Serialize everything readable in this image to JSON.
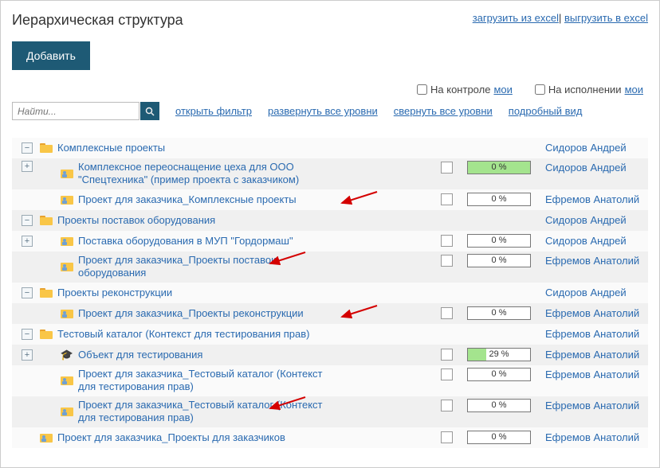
{
  "title": "Иерархическая структура",
  "header_links": {
    "import": "загрузить из excel",
    "export": "выгрузить в excel"
  },
  "add_btn": "Добавить",
  "search": {
    "placeholder": "Найти..."
  },
  "toolbar": {
    "open_filter": "открыть фильтр",
    "expand_all": "развернуть все уровни",
    "collapse_all": "свернуть все уровни",
    "detailed": "подробный вид",
    "on_control_txt": "На контроле",
    "on_exec_txt": "На исполнении",
    "mine": "мои"
  },
  "owners": {
    "sidorov": "Сидоров Андрей",
    "efremov": "Ефремов Анатолий"
  },
  "tree": [
    {
      "depth": 0,
      "toggle": "-",
      "icon": "folder",
      "label": "Комплексные проекты",
      "owner": "sidorov",
      "chk": false,
      "bar": null,
      "arrow": false
    },
    {
      "depth": 1,
      "toggle": "+",
      "icon": "person",
      "label": "Комплексное переоснащение цеха для ООО \"Спецтехника\" (пример проекта с заказчиком)",
      "owner": "sidorov",
      "chk": true,
      "bar": {
        "pct": 0,
        "green": true
      },
      "arrow": false,
      "wrap": true
    },
    {
      "depth": 1,
      "toggle": "",
      "icon": "person",
      "label": "Проект для заказчика_Комплексные проекты",
      "owner": "efremov",
      "chk": true,
      "bar": {
        "pct": 0,
        "green": false
      },
      "arrow": true
    },
    {
      "depth": 0,
      "toggle": "-",
      "icon": "folder",
      "label": "Проекты поставок оборудования",
      "owner": "sidorov",
      "chk": false,
      "bar": null,
      "arrow": false
    },
    {
      "depth": 1,
      "toggle": "+",
      "icon": "person",
      "label": "Поставка оборудования в МУП \"Гордормаш\"",
      "owner": "sidorov",
      "chk": true,
      "bar": {
        "pct": 0,
        "green": false
      },
      "arrow": false
    },
    {
      "depth": 1,
      "toggle": "",
      "icon": "person",
      "label": "Проект для заказчика_Проекты поставок оборудования",
      "owner": "efremov",
      "chk": true,
      "bar": {
        "pct": 0,
        "green": false
      },
      "arrow": true,
      "wrap": true
    },
    {
      "depth": 0,
      "toggle": "-",
      "icon": "folder",
      "label": "Проекты реконструкции",
      "owner": "sidorov",
      "chk": false,
      "bar": null,
      "arrow": false
    },
    {
      "depth": 1,
      "toggle": "",
      "icon": "person",
      "label": "Проект для заказчика_Проекты реконструкции",
      "owner": "efremov",
      "chk": true,
      "bar": {
        "pct": 0,
        "green": false
      },
      "arrow": true
    },
    {
      "depth": 0,
      "toggle": "-",
      "icon": "folder",
      "label": "Тестовый каталог (Контекст для тестирования прав)",
      "owner": "efremov",
      "chk": false,
      "bar": null,
      "arrow": false
    },
    {
      "depth": 1,
      "toggle": "+",
      "icon": "hat",
      "label": "Объект для тестирования",
      "owner": "efremov",
      "chk": true,
      "bar": {
        "pct": 29,
        "green": true
      },
      "arrow": false
    },
    {
      "depth": 1,
      "toggle": "",
      "icon": "person",
      "label": "Проект для заказчика_Тестовый каталог (Контекст для тестирования прав)",
      "owner": "efremov",
      "chk": true,
      "bar": {
        "pct": 0,
        "green": false
      },
      "arrow": false,
      "wrap": true
    },
    {
      "depth": 1,
      "toggle": "",
      "icon": "person",
      "label": "Проект для заказчика_Тестовый каталог (Контекст для тестирования прав)",
      "owner": "efremov",
      "chk": true,
      "bar": {
        "pct": 0,
        "green": false
      },
      "arrow": true,
      "wrap": true
    },
    {
      "depth": 0,
      "toggle": "",
      "icon": "person",
      "label": "Проект для заказчика_Проекты для заказчиков",
      "owner": "efremov",
      "chk": true,
      "bar": {
        "pct": 0,
        "green": false
      },
      "arrow": false
    }
  ]
}
